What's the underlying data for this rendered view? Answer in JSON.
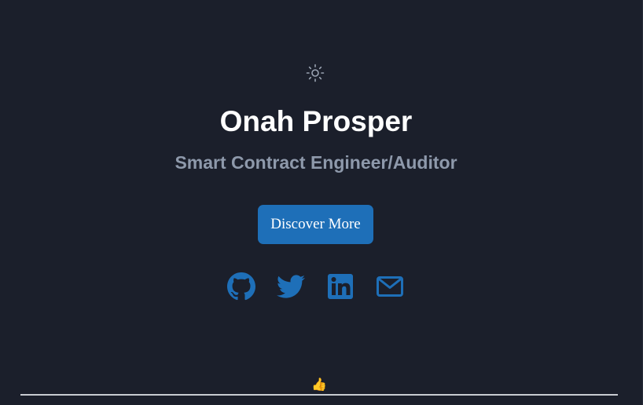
{
  "hero": {
    "theme_toggle_icon": "sun-icon",
    "name": "Onah Prosper",
    "role": "Smart Contract Engineer/Auditor",
    "cta_label": "Discover More"
  },
  "social": {
    "links": [
      {
        "icon": "github-icon"
      },
      {
        "icon": "twitter-icon"
      },
      {
        "icon": "linkedin-icon"
      },
      {
        "icon": "mail-icon"
      }
    ]
  },
  "footer": {
    "emoji": "👍"
  },
  "colors": {
    "background": "#1b1f2b",
    "accent": "#1e6fb8",
    "heading": "#ffffff",
    "subheading": "#8e99ab"
  }
}
